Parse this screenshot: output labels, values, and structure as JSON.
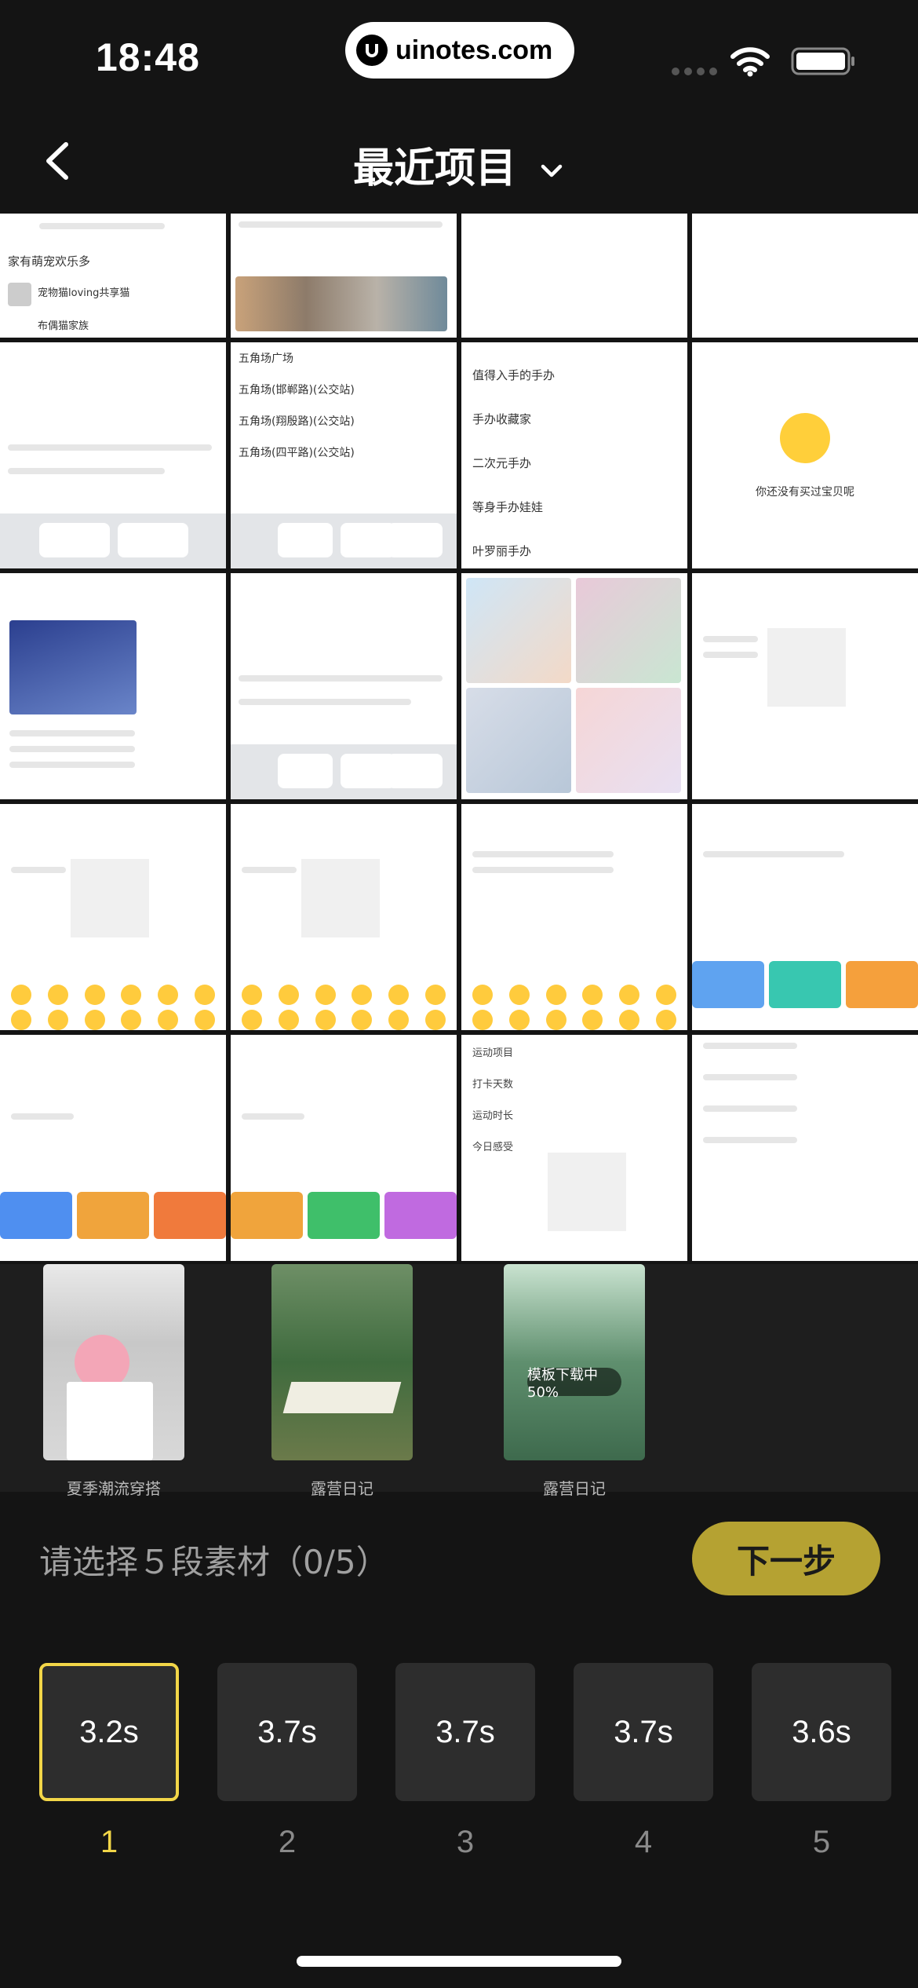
{
  "status_bar": {
    "time": "18:48",
    "url": "uinotes.com"
  },
  "nav": {
    "title": "最近项目"
  },
  "film_strip": {
    "labels": [
      "夏季潮流穿搭",
      "露营日记",
      "露营日记"
    ],
    "progress_text": "模板下载中 50%"
  },
  "selection": {
    "hint": "请选择５段素材（0/5）",
    "next_button": "下一步"
  },
  "slots": [
    {
      "duration": "3.2s",
      "index": "1",
      "active": true
    },
    {
      "duration": "3.7s",
      "index": "2",
      "active": false
    },
    {
      "duration": "3.7s",
      "index": "3",
      "active": false
    },
    {
      "duration": "3.7s",
      "index": "4",
      "active": false
    },
    {
      "duration": "3.6s",
      "index": "5",
      "active": false
    }
  ],
  "grid_preview_text": {
    "r2c3": [
      "值得入手的手办",
      "手办收藏家",
      "二次元手办",
      "等身手办娃娃",
      "叶罗丽手办"
    ],
    "r2c2": [
      "五角场广场",
      "五角场(邯郸路)(公交站)",
      "五角场(翔殷路)(公交站)",
      "五角场(四平路)(公交站)"
    ],
    "r2c4": "你还没有买过宝贝呢",
    "r5c3": [
      "运动项目",
      "打卡天数",
      "运动时长",
      "今日感受"
    ],
    "r1c1": [
      "家有萌宠欢乐多",
      "宠物猫loving共享猫",
      "布偶猫家族"
    ]
  },
  "colors": {
    "accent": "#f2d648",
    "button": "#b5a232",
    "background": "#141414"
  }
}
